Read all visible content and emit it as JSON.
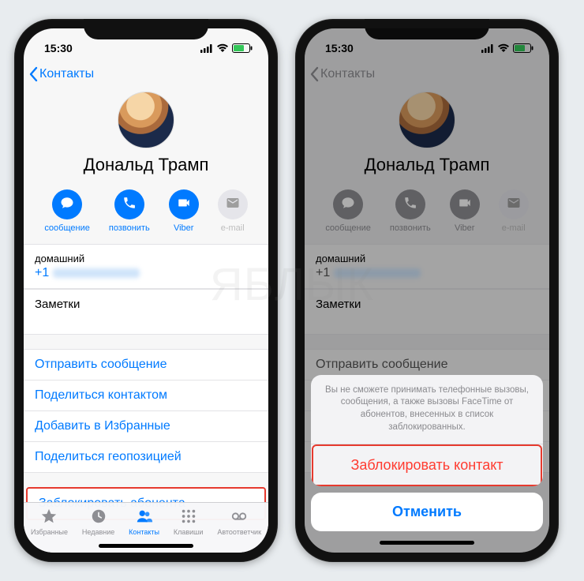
{
  "status": {
    "time": "15:30"
  },
  "nav": {
    "back": "Контакты"
  },
  "contact": {
    "name": "Дональд Трамп"
  },
  "actions": {
    "message": "сообщение",
    "call": "позвонить",
    "viber": "Viber",
    "email": "e-mail"
  },
  "phone_section": {
    "label": "домашний",
    "prefix": "+1"
  },
  "notes_label": "Заметки",
  "links": {
    "send_message": "Отправить сообщение",
    "share_contact": "Поделиться контактом",
    "add_favorites": "Добавить в Избранные",
    "share_location": "Поделиться геопозицией",
    "block_caller": "Заблокировать абонента"
  },
  "tabs": {
    "favorites": "Избранные",
    "recents": "Недавние",
    "contacts": "Контакты",
    "keypad": "Клавиши",
    "voicemail": "Автоответчик"
  },
  "sheet": {
    "message": "Вы не сможете принимать телефонные вызовы, сообщения, а также вызовы FaceTime от абонентов, внесенных в список заблокированных.",
    "block": "Заблокировать контакт",
    "cancel": "Отменить"
  },
  "watermark": "ЯБЛЫК"
}
